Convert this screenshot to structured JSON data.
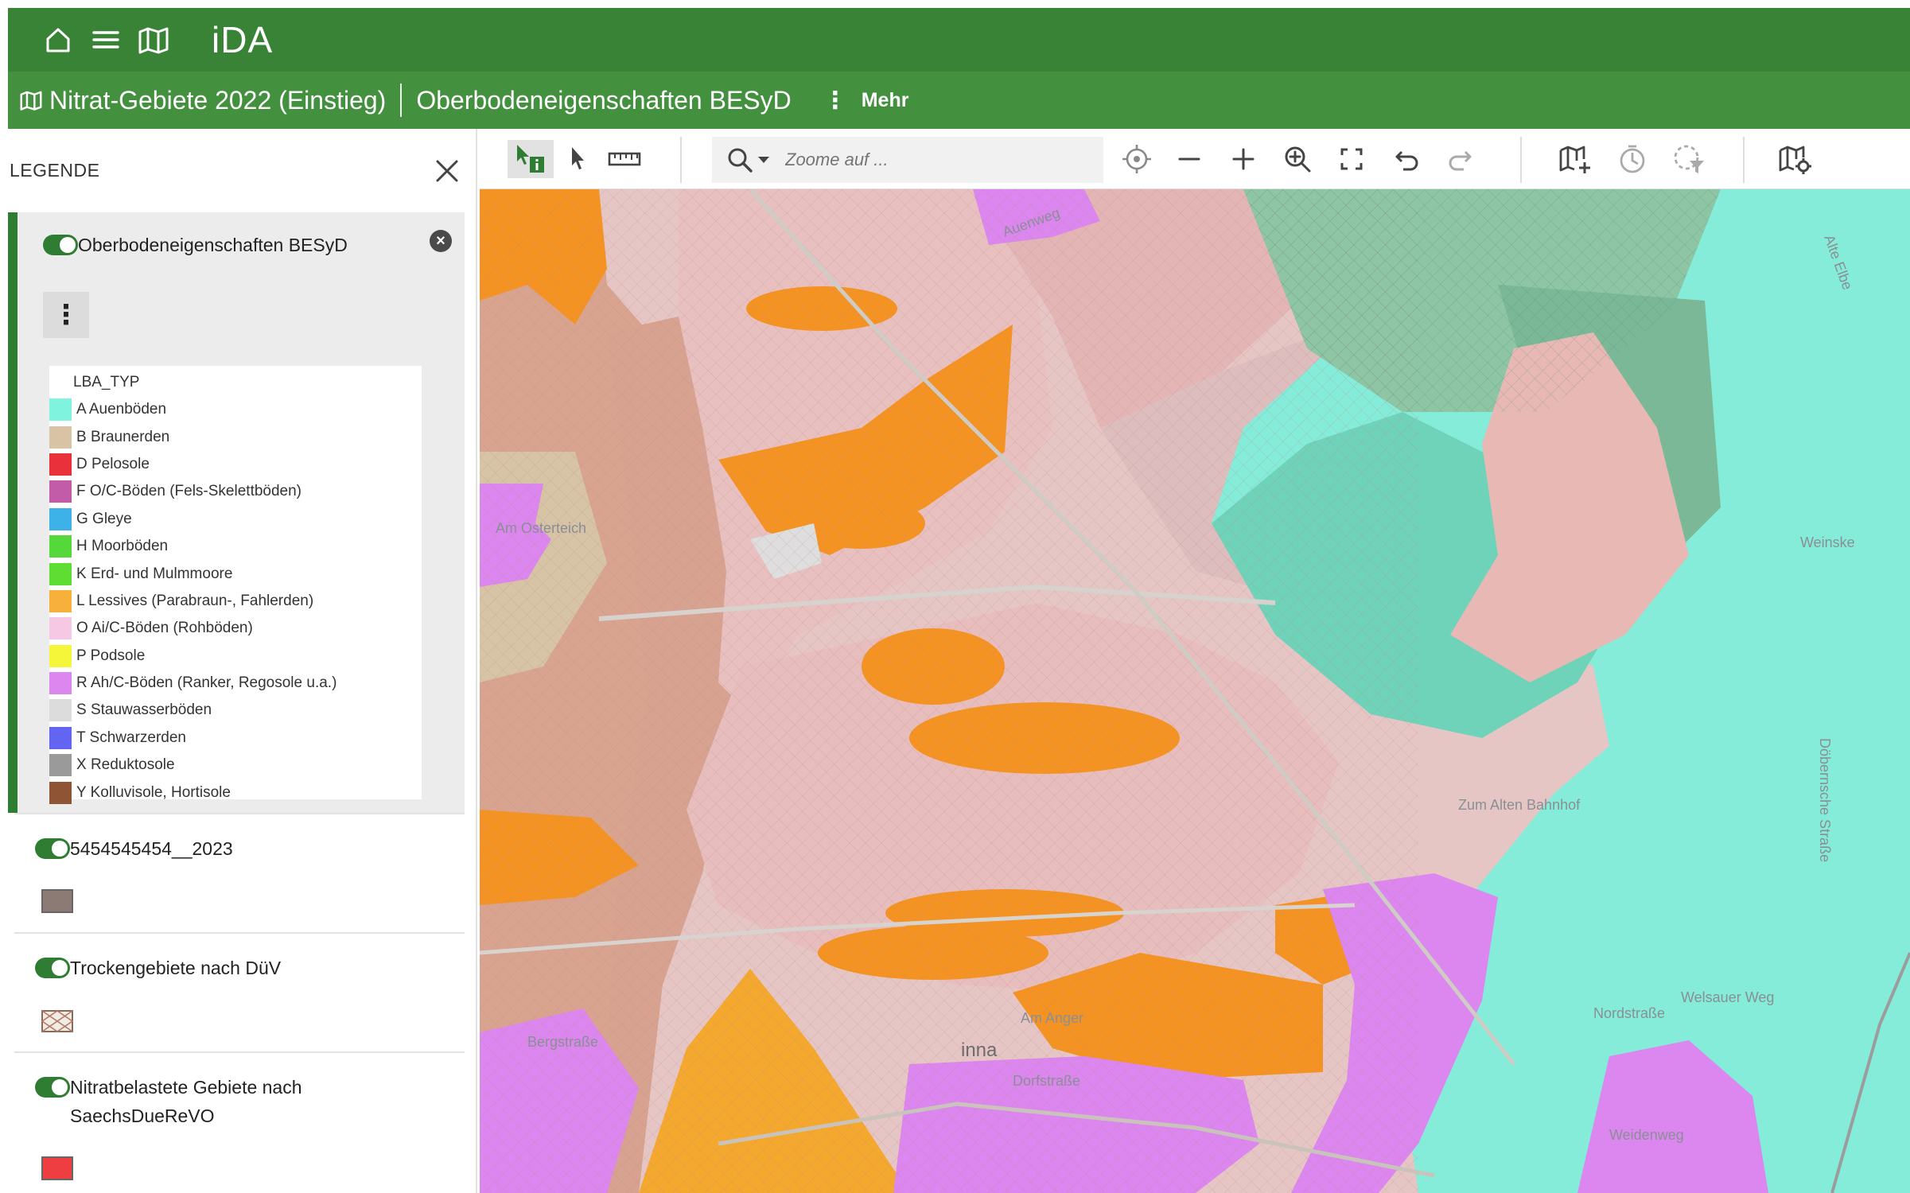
{
  "app": {
    "title": "iDA"
  },
  "topbar": {
    "icons": [
      "home-icon",
      "menu-icon",
      "map-icon"
    ]
  },
  "subbar": {
    "crumb1": "Nitrat-Gebiete 2022 (Einstieg)",
    "crumb2": "Oberbodeneigenschaften BESyD",
    "more": "Mehr"
  },
  "legend": {
    "title": "LEGENDE",
    "layers": [
      {
        "name": "Oberbodeneigenschaften BESyD",
        "table_header": "LBA_TYP",
        "entries": [
          {
            "label": "A  Auenböden",
            "color": "#7ff3de"
          },
          {
            "label": "B  Braunerden",
            "color": "#d8c3a5"
          },
          {
            "label": "D  Pelosole",
            "color": "#e8313b"
          },
          {
            "label": "F  O/C-Böden (Fels-Skelettböden)",
            "color": "#c25ca8"
          },
          {
            "label": "G  Gleye",
            "color": "#3cb2e8"
          },
          {
            "label": "H  Moorböden",
            "color": "#55d93a"
          },
          {
            "label": "K  Erd- und Mulmmoore",
            "color": "#60dd32"
          },
          {
            "label": "L  Lessives (Parabraun-, Fahlerden)",
            "color": "#f7b13a"
          },
          {
            "label": "O  Ai/C-Böden (Rohböden)",
            "color": "#f6c8e4"
          },
          {
            "label": "P  Podsole",
            "color": "#f5f53a"
          },
          {
            "label": "R  Ah/C-Böden (Ranker, Regosole u.a.)",
            "color": "#dc86ef"
          },
          {
            "label": "S  Stauwasserböden",
            "color": "#dcdcdc"
          },
          {
            "label": "T  Schwarzerden",
            "color": "#6464f2"
          },
          {
            "label": "X  Reduktosole",
            "color": "#9a9a9a"
          },
          {
            "label": "Y  Kolluvisole, Hortisole",
            "color": "#8e5434"
          }
        ]
      },
      {
        "name": "5454545454__2023",
        "swatch": "#8c7a74"
      },
      {
        "name": "Trockengebiete nach DüV"
      },
      {
        "name": "Nitratbelastete Gebiete nach",
        "name2": "SaechsDueReVO",
        "swatch": "#ee3e42"
      }
    ]
  },
  "toolbar": {
    "zoom_placeholder": "Zoome auf ..."
  },
  "map": {
    "labels": {
      "am_osterteich": "Am Osterteich",
      "bergstrasse": "Bergstraße",
      "dorfstrasse": "Dorfstraße",
      "am_anger": "Am Anger",
      "zum_alten_bahnhof": "Zum Alten Bahnhof",
      "nordstrasse": "Nordstraße",
      "welsauer_weg": "Welsauer Weg",
      "doebernsche_strasse": "Döbernsche Straße",
      "weinske": "Weinske",
      "alte_elbe": "Alte Elbe",
      "weidenweg": "Weidenweg",
      "inna": "inna",
      "auenweg": "Auenweg"
    }
  }
}
